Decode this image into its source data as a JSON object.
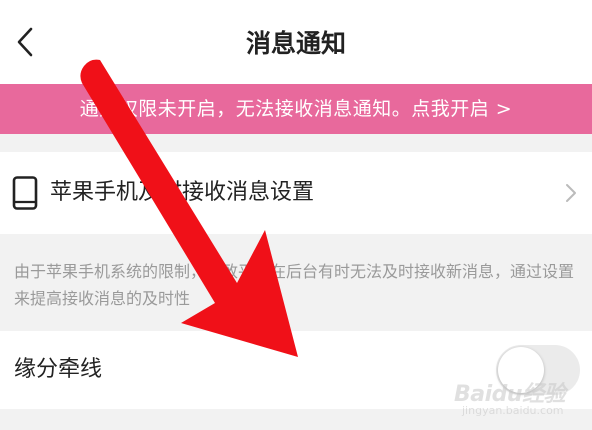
{
  "header": {
    "title": "消息通知",
    "back_icon": "chevron-left-icon"
  },
  "banner": {
    "text": "通知权限未开启，无法接收消息通知。点我开启 >",
    "color": "#e8699c"
  },
  "ios_setting_row": {
    "label": "苹果手机及时接收消息设置",
    "icon": "phone-icon",
    "trailing_icon": "chevron-right-icon"
  },
  "hint": {
    "text": "由于苹果手机系统的限制，导致平台在后台有时无法及时接收新消息，通过设置来提高接收消息的及时性"
  },
  "toggle_row": {
    "label": "缘分牵线",
    "enabled": false
  },
  "watermark": {
    "main": "Baidu经验",
    "sub": "jingyan.baidu.com"
  },
  "overlay": {
    "arrow_color": "#f01018"
  }
}
